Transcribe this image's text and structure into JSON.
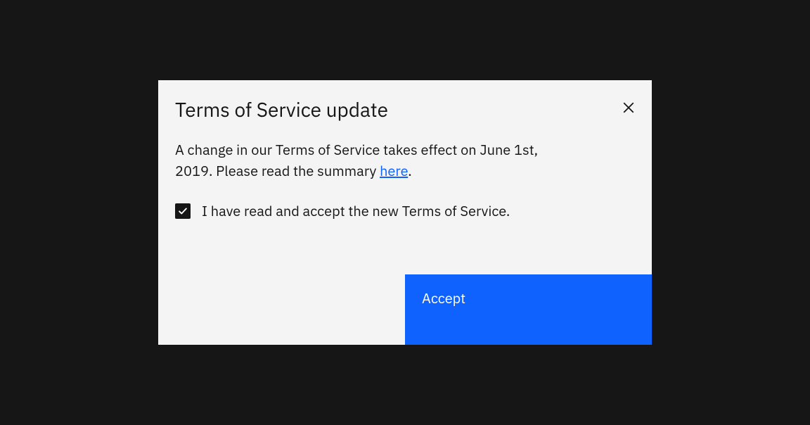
{
  "modal": {
    "title": "Terms of Service update",
    "body_text_before": "A change in our Terms of Service takes effect on June 1st, 2019. Please read the summary ",
    "body_link": "here",
    "body_text_after": ".",
    "checkbox_label": "I have read and accept the new Terms of Service.",
    "checkbox_checked": true,
    "accept_label": "Accept"
  }
}
